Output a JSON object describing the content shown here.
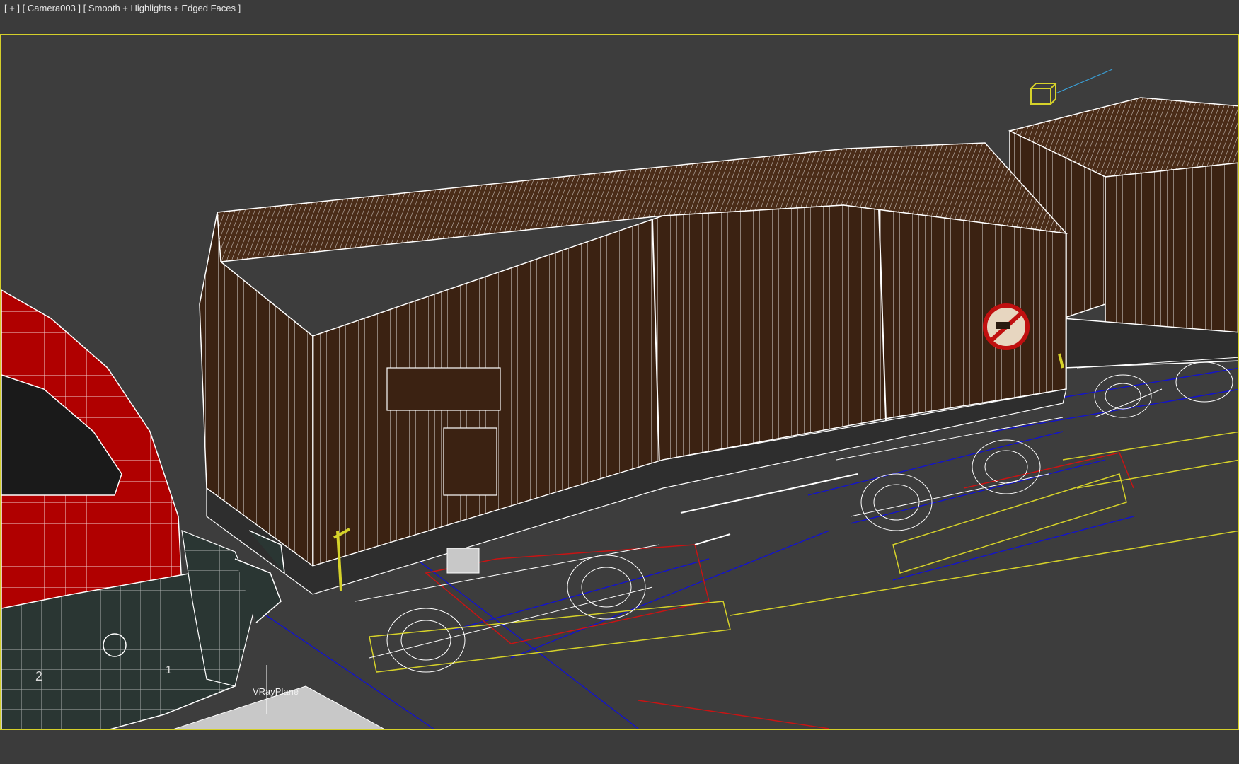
{
  "viewport": {
    "label_plus": "[ + ]",
    "label_camera": "[ Camera003 ]",
    "label_shading": "[ Smooth + Highlights + Edged Faces ]",
    "active_border_color": "#d4cf2a"
  },
  "scene": {
    "plane_label": "VRayPlane",
    "loco_number_left": "2",
    "loco_number_right": "1",
    "colors": {
      "background": "#3d3d3d",
      "wagon_body": "#3b2212",
      "wagon_roof": "#4a2c18",
      "wireframe": "#ffffff",
      "loco_red": "#b00000",
      "loco_dark": "#2a3633",
      "selection_yellow": "#d6d22a",
      "blue_lines": "#1414c8",
      "red_lines": "#c81414",
      "camera_line": "#3aa0d8"
    }
  }
}
